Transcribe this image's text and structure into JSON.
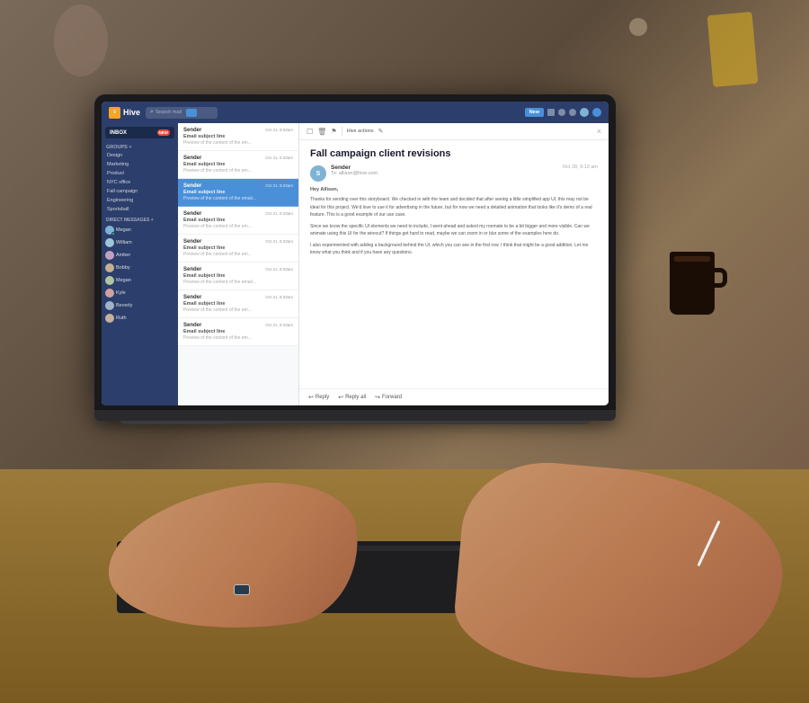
{
  "app": {
    "title": "Hive",
    "logo_text": "Hive",
    "new_button": "New",
    "close_label": "×"
  },
  "top_bar": {
    "search_placeholder": "Search mail",
    "icons": [
      "grid-icon",
      "check-icon",
      "bell-icon",
      "user-icon",
      "avatar-icon"
    ]
  },
  "sidebar": {
    "inbox_label": "INBOX",
    "inbox_badge": "NEW",
    "groups_title": "GROUPS +",
    "groups": [
      {
        "label": "Design"
      },
      {
        "label": "Marketing"
      },
      {
        "label": "Product"
      },
      {
        "label": "NYC office"
      },
      {
        "label": "Fall campaign"
      },
      {
        "label": "Engineering"
      },
      {
        "label": "Sportsball"
      }
    ],
    "dm_title": "DIRECT MESSAGES +",
    "dms": [
      {
        "name": "Megan",
        "online": true
      },
      {
        "name": "William",
        "online": false
      },
      {
        "name": "Amber",
        "online": false
      },
      {
        "name": "Bobby",
        "online": false
      },
      {
        "name": "Megan",
        "online": false
      },
      {
        "name": "Kyle",
        "online": false
      },
      {
        "name": "Beverly",
        "online": false
      },
      {
        "name": "Ruth",
        "online": false
      }
    ]
  },
  "email_list": {
    "items": [
      {
        "sender": "Sender",
        "date": "Oct 21, 9:33am",
        "subject": "Email subject line",
        "preview": "Preview of the content of the em...",
        "selected": false
      },
      {
        "sender": "Sender",
        "date": "Oct 21, 9:33am",
        "subject": "Email subject line",
        "preview": "Preview of the content of the em...",
        "selected": false
      },
      {
        "sender": "Sender",
        "date": "Oct 21, 9:33am",
        "subject": "Email subject line",
        "preview": "Preview of the content of the email...",
        "selected": true
      },
      {
        "sender": "Sender",
        "date": "Oct 21, 9:33am",
        "subject": "Email subject line",
        "preview": "Preview of the content of the em...",
        "selected": false
      },
      {
        "sender": "Sender",
        "date": "Oct 21, 9:33am",
        "subject": "Email subject line",
        "preview": "Preview of the content of the em...",
        "selected": false
      },
      {
        "sender": "Sender",
        "date": "Oct 21, 9:33am",
        "subject": "Email subject line",
        "preview": "Preview of the content of the email...",
        "selected": false
      },
      {
        "sender": "Sender",
        "date": "Oct 21, 9:33am",
        "subject": "Email subject line",
        "preview": "Preview of the content of the em...",
        "selected": false
      },
      {
        "sender": "Sender",
        "date": "Oct 21, 9:33am",
        "subject": "Email subject line",
        "preview": "Preview of the content of the em...",
        "selected": false
      }
    ]
  },
  "email_detail": {
    "title": "Fall campaign client revisions",
    "sender": "Sender",
    "to": "To: allison@hive.com",
    "date": "Oct 28, 9:13 am",
    "greeting": "Hey Allison,",
    "body_paragraphs": [
      "Thanks for sending over this storyboard. We checked in with the team and decided that after seeing a little simplified app UI, this may not be ideal for this project. We'd love to use it for advertising in the future, but for now we need a detailed animation that looks like it's demo of a real feature. This is a good example of our use case.",
      "Since we know the specific UI elements we need to include, I went ahead and asked my roomate to be a bit bigger and more visible. Can we animate using this UI for the wirecut? If things get hard to read, maybe we can zoom in or blur some of the examples here do.",
      "I also experimented with adding a background behind the UI, which you can see in the first row. I think that might be a good addition. Let me know what you think and if you have any questions."
    ],
    "actions": {
      "reply": "Reply",
      "reply_all": "Reply all",
      "forward": "Forward"
    },
    "toolbar_items": [
      "archive-icon",
      "trash-icon",
      "flag-icon",
      "hive-actions-label",
      "edit-icon"
    ]
  }
}
